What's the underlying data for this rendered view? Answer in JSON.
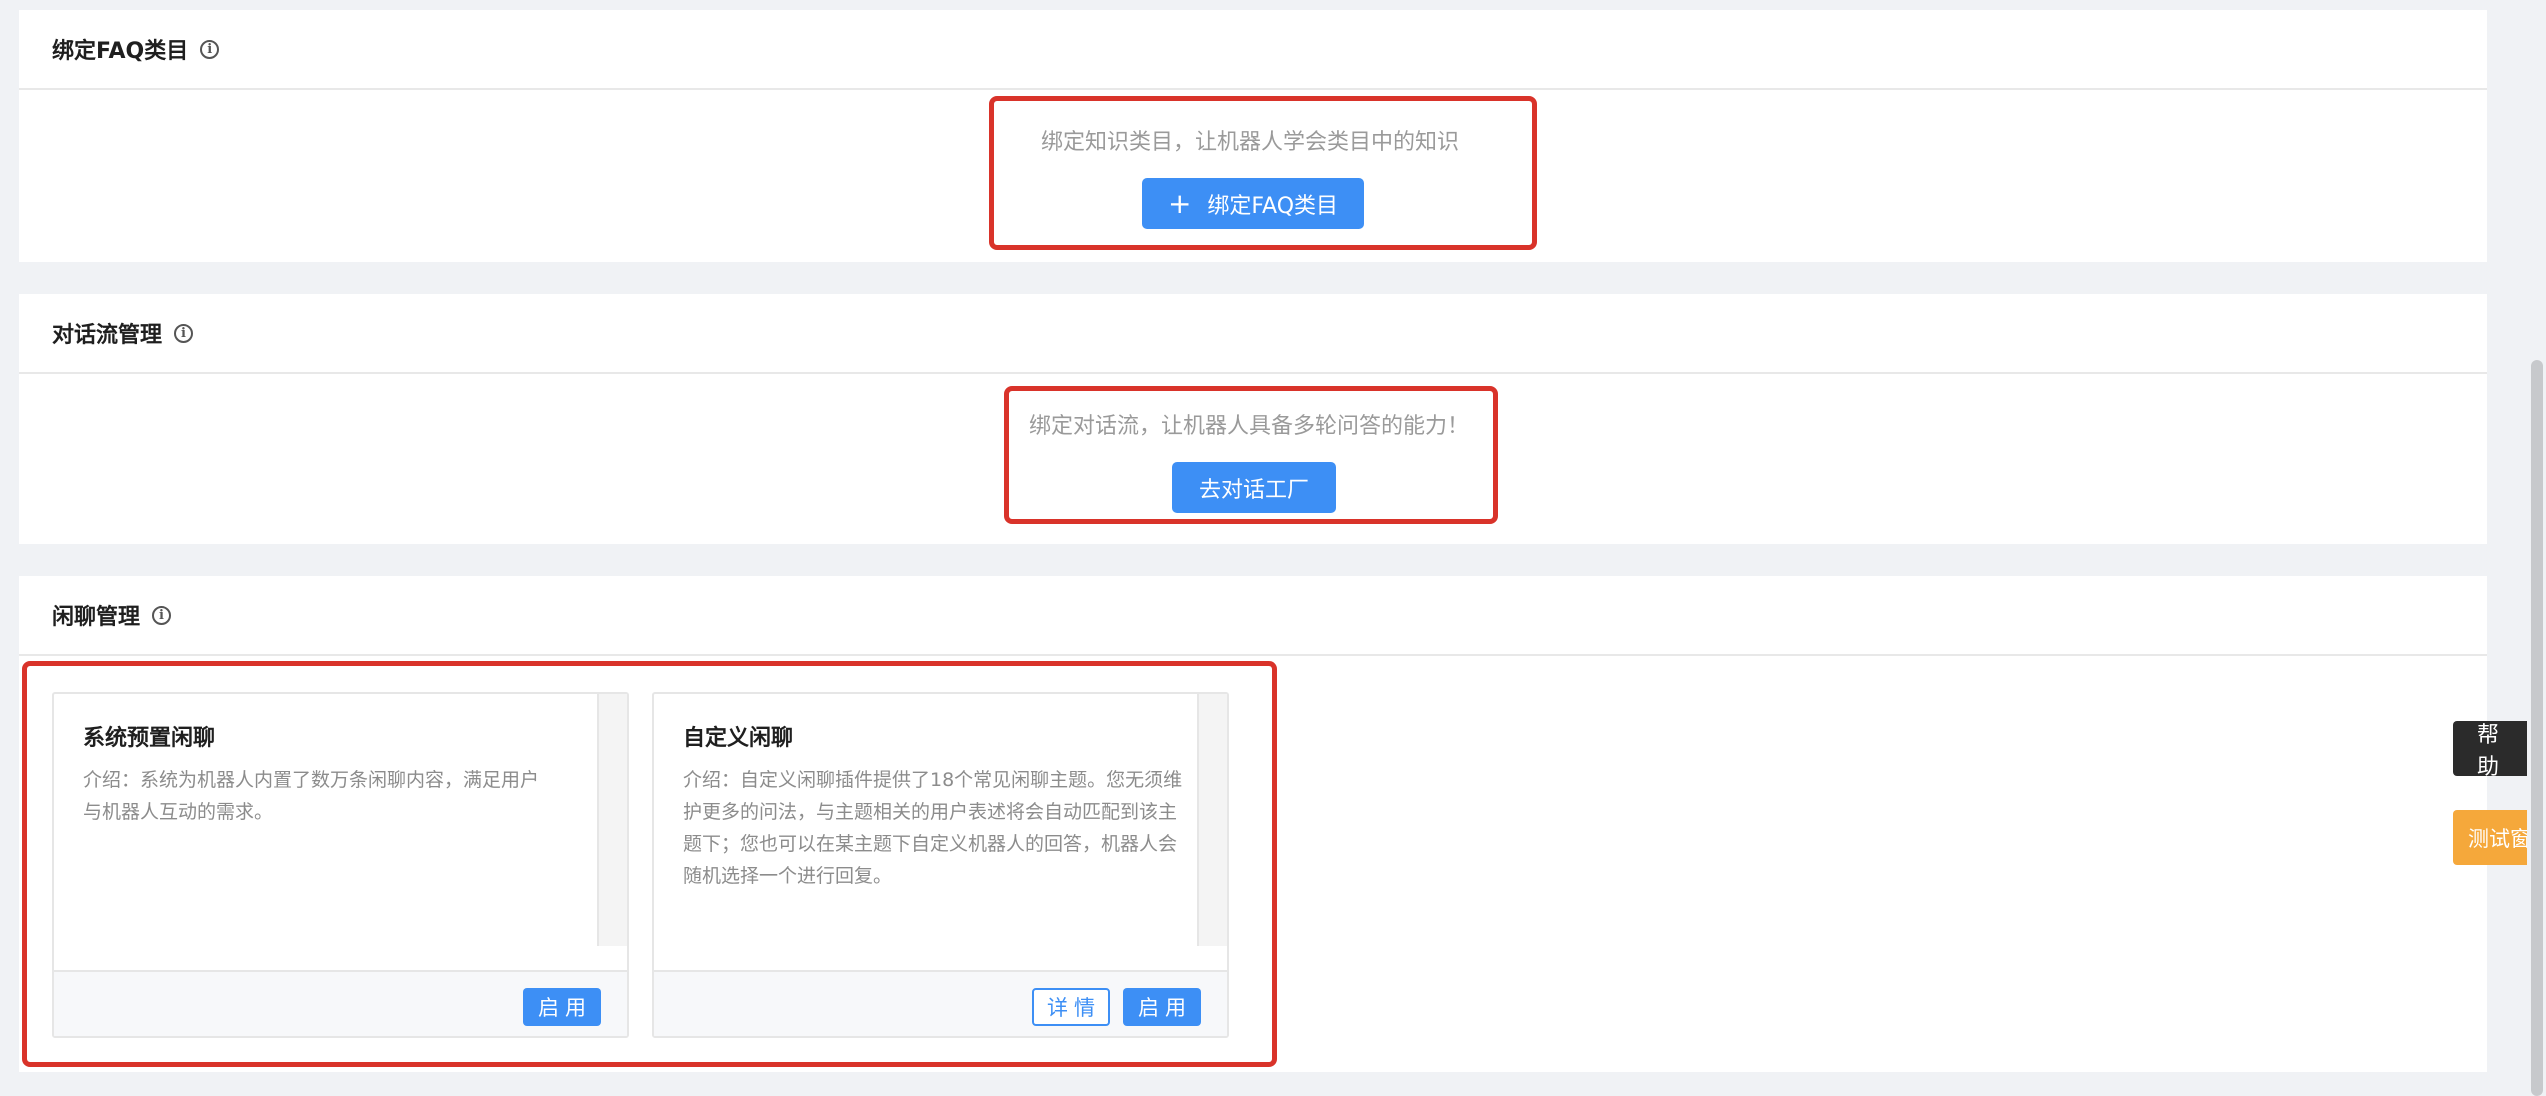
{
  "faq_section": {
    "title": "绑定FAQ类目",
    "info_icon": "info-circle-icon",
    "hint": "绑定知识类目，让机器人学会类目中的知识",
    "button_icon": "plus-icon",
    "button_label": "绑定FAQ类目"
  },
  "dialog_flow_section": {
    "title": "对话流管理",
    "info_icon": "info-circle-icon",
    "hint": "绑定对话流，让机器人具备多轮问答的能力！",
    "button_label": "去对话工厂"
  },
  "chitchat_section": {
    "title": "闲聊管理",
    "info_icon": "info-circle-icon",
    "cards": [
      {
        "title": "系统预置闲聊",
        "description": "介绍：系统为机器人内置了数万条闲聊内容，满足用户与机器人互动的需求。",
        "enable_label": "启用"
      },
      {
        "title": "自定义闲聊",
        "description": "介绍：自定义闲聊插件提供了18个常见闲聊主题。您无须维护更多的问法，与主题相关的用户表述将会自动匹配到该主题下；您也可以在某主题下自定义机器人的回答，机器人会随机选择一个进行回复。",
        "details_label": "详情",
        "enable_label": "启用"
      }
    ]
  },
  "side_tabs": {
    "help_label": "帮助",
    "test_window_label": "测试窗"
  },
  "colors": {
    "primary": "#3d8ff5",
    "highlight_box": "#d9332a",
    "help_tab": "#2b2b2b",
    "test_tab": "#f5a83b",
    "page_background": "#f0f2f5"
  }
}
